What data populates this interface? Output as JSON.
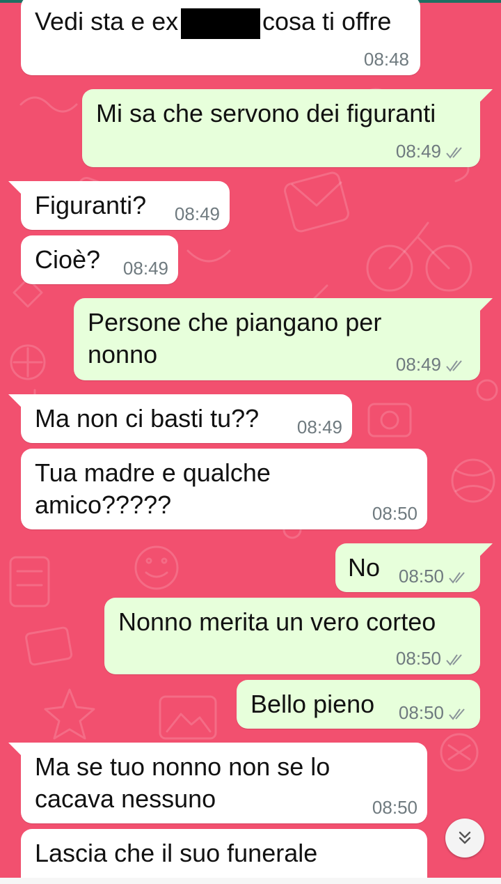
{
  "colors": {
    "background": "#f2506f",
    "incoming_bubble": "#ffffff",
    "outgoing_bubble": "#e7ffdb",
    "timestamp": "#6f7a7f",
    "read_ticks": "#8a9499"
  },
  "messages": [
    {
      "direction": "incoming",
      "text": "Vedi sta e ex",
      "text_tail": "cosa ti offre",
      "time": "08:48",
      "redacted": true
    },
    {
      "direction": "outgoing",
      "text": "Mi sa che servono dei figuranti",
      "time": "08:49",
      "status": "read-ticks-icon"
    },
    {
      "direction": "incoming",
      "text": "Figuranti?",
      "time": "08:49"
    },
    {
      "direction": "incoming",
      "text": "Cioè?",
      "time": "08:49"
    },
    {
      "direction": "outgoing",
      "text": "Persone che piangano per\nnonno",
      "time": "08:49",
      "status": "read-ticks-icon"
    },
    {
      "direction": "incoming",
      "text": "Ma non ci basti tu??",
      "time": "08:49"
    },
    {
      "direction": "incoming",
      "text": "Tua madre e qualche\namico?????",
      "time": "08:50"
    },
    {
      "direction": "outgoing",
      "text": "No",
      "time": "08:50",
      "status": "read-ticks-icon"
    },
    {
      "direction": "outgoing",
      "text": "Nonno merita un vero corteo",
      "time": "08:50",
      "status": "read-ticks-icon"
    },
    {
      "direction": "outgoing",
      "text": "Bello pieno",
      "time": "08:50",
      "status": "read-ticks-icon"
    },
    {
      "direction": "incoming",
      "text": "Ma se tuo nonno non se lo\ncacava nessuno",
      "time": "08:50"
    },
    {
      "direction": "incoming",
      "text": "Lascia che il suo funerale",
      "time": ""
    }
  ],
  "scroll_button": {
    "icon": "double-chevron-down-icon"
  }
}
